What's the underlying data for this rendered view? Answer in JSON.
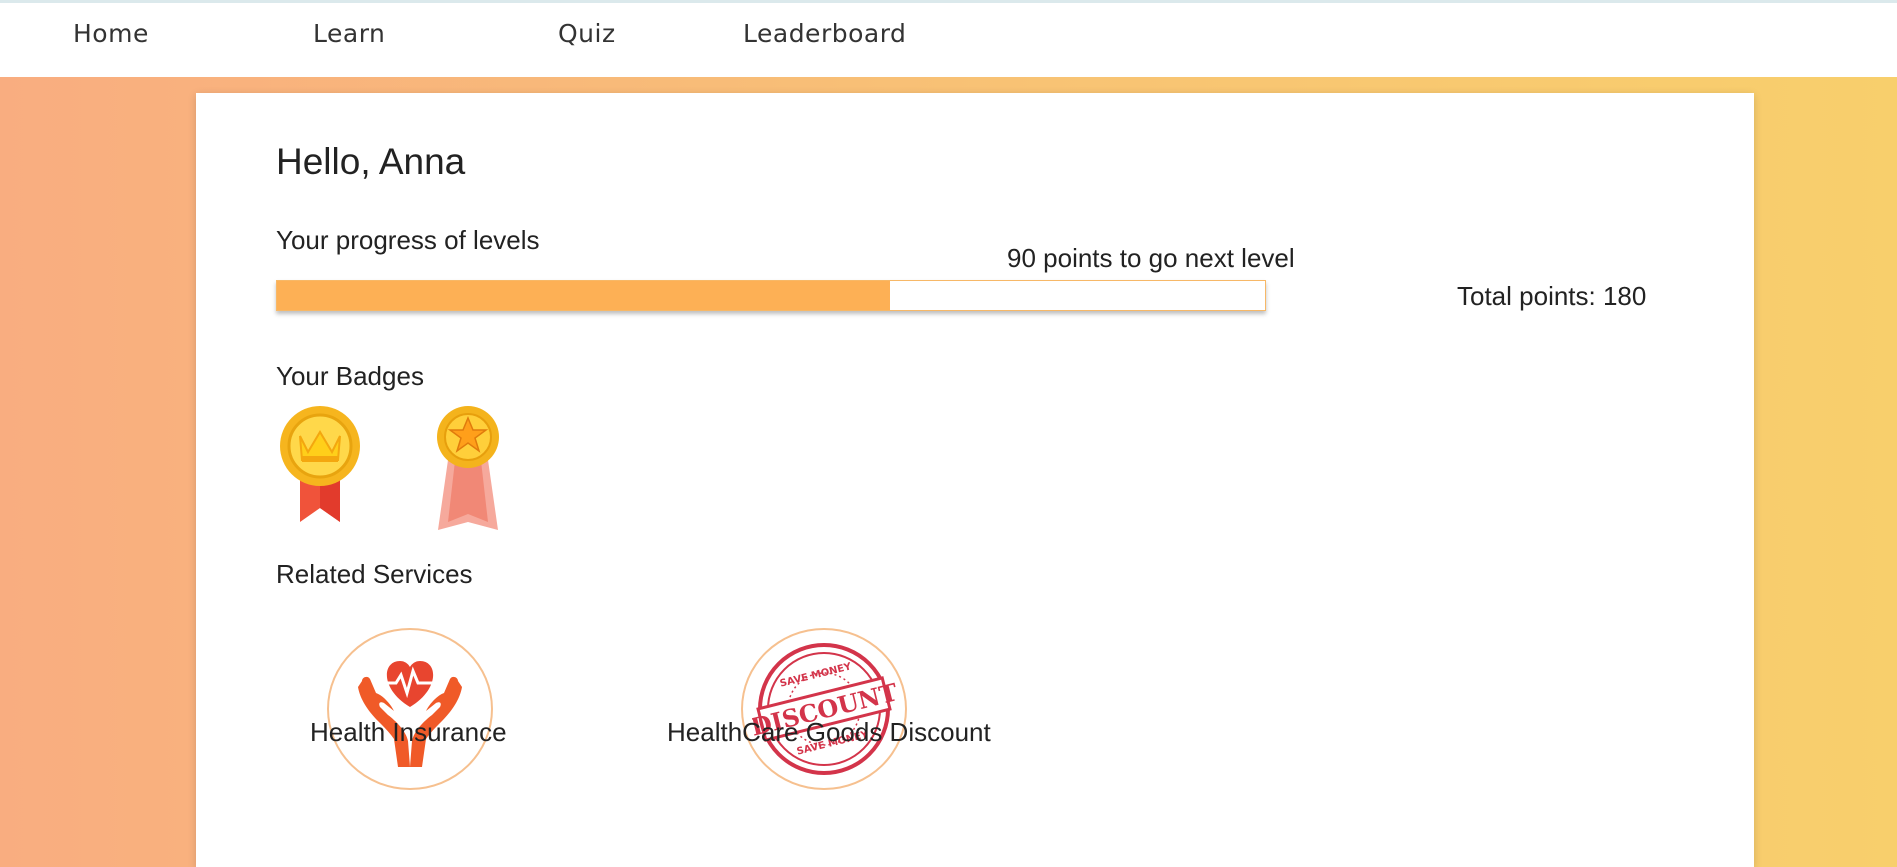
{
  "nav": {
    "items": [
      {
        "label": "Home"
      },
      {
        "label": "Learn"
      },
      {
        "label": "Quiz"
      },
      {
        "label": "Leaderboard"
      }
    ]
  },
  "dashboard": {
    "greeting": "Hello, Anna",
    "progress_label": "Your progress of levels",
    "next_level_text": "90 points to go next level",
    "progress_fraction": 0.62,
    "total_points_text": "Total points: 180",
    "badges_label": "Your Badges",
    "badges": [
      {
        "icon": "crown-medal-icon"
      },
      {
        "icon": "star-medal-icon"
      }
    ],
    "services_label": "Related Services",
    "services": [
      {
        "label": "Health Insurance",
        "icon": "heart-hands-icon"
      },
      {
        "label": "HealthCare Goods Discount",
        "icon": "discount-stamp-icon",
        "stamp_top": "SAVE MONEY",
        "stamp_main": "DISCOUNT",
        "stamp_bottom": "SAVE MONEY"
      }
    ]
  },
  "colors": {
    "accent": "#fdb055",
    "bg_left": "#f9ad80",
    "bg_right": "#f8cf6c"
  }
}
